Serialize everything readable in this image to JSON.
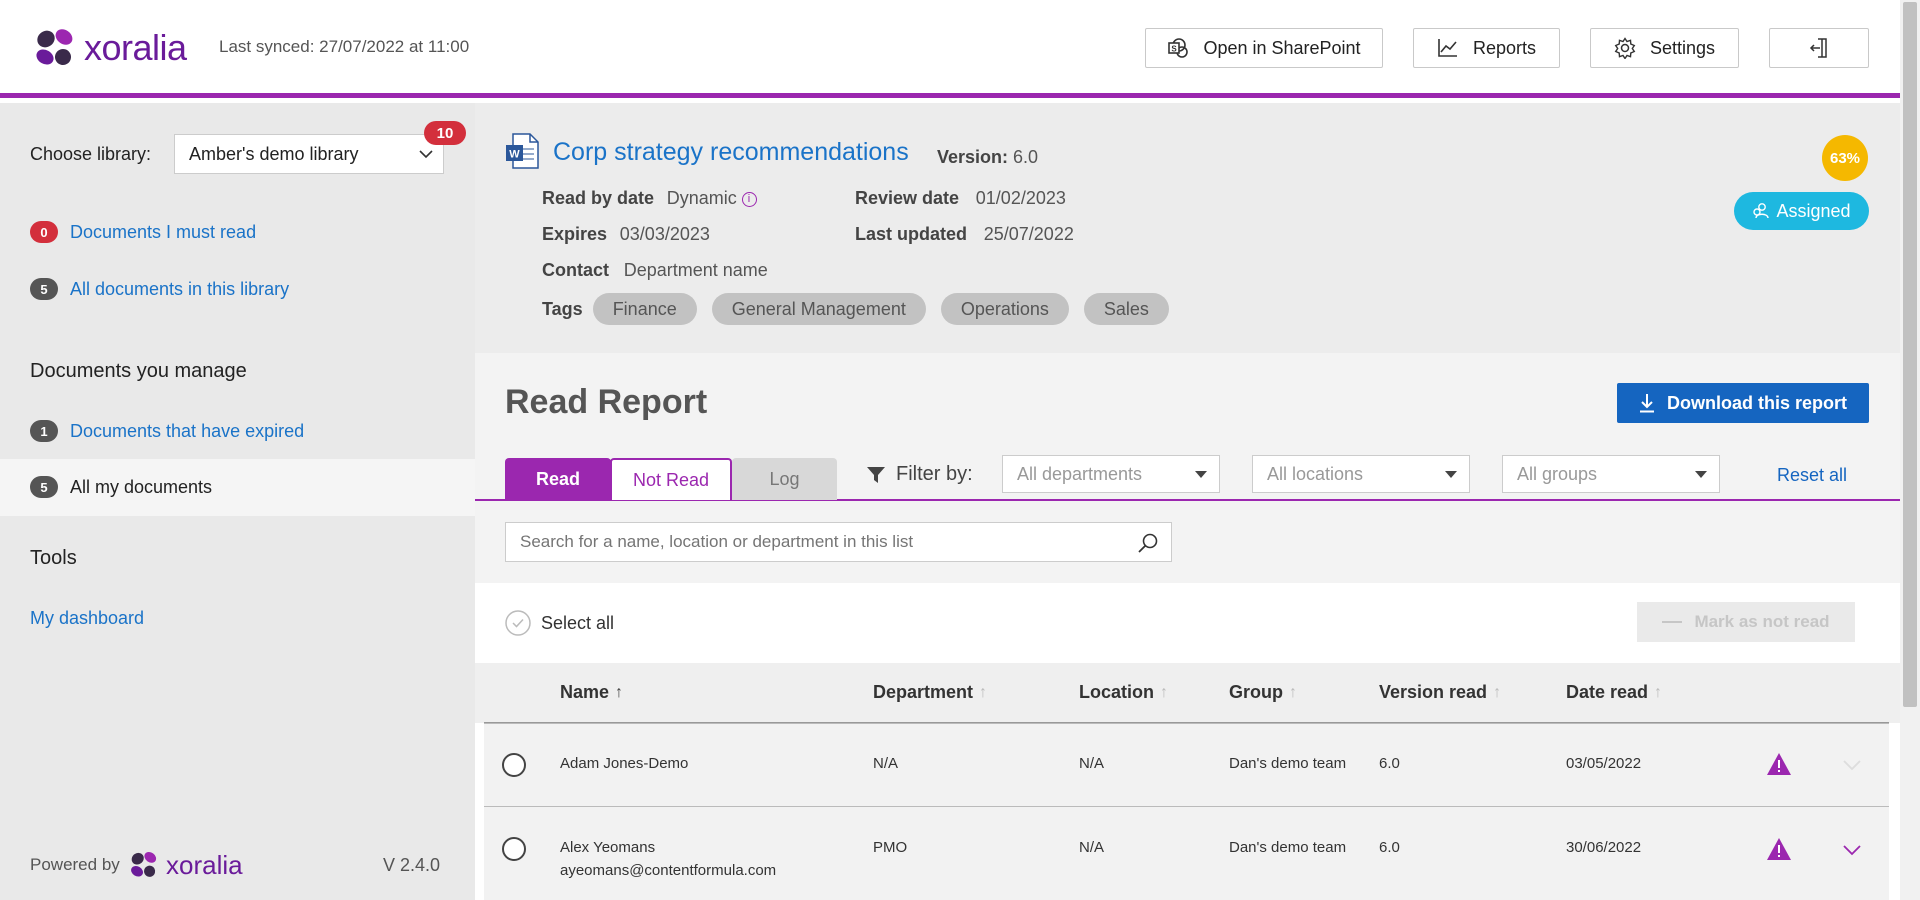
{
  "header": {
    "brand": "xoralia",
    "last_synced": "Last synced: 27/07/2022 at 11:00",
    "open_sharepoint": "Open in SharePoint",
    "reports": "Reports",
    "settings": "Settings"
  },
  "sidebar": {
    "choose_library_label": "Choose library:",
    "library_selected": "Amber's demo library",
    "library_badge": "10",
    "links": [
      {
        "count": "0",
        "label": "Documents I must read"
      },
      {
        "count": "5",
        "label": "All documents in this library"
      }
    ],
    "manage_heading": "Documents you manage",
    "manage_links": [
      {
        "count": "1",
        "label": "Documents that have expired"
      },
      {
        "count": "5",
        "label": "All my documents"
      }
    ],
    "tools_heading": "Tools",
    "dashboard": "My dashboard",
    "powered_by": "Powered by",
    "powered_brand": "xoralia",
    "version": "V 2.4.0"
  },
  "document": {
    "title": "Corp strategy recommendations",
    "version_label": "Version:",
    "version_value": "6.0",
    "read_by_label": "Read by date",
    "read_by_value": "Dynamic",
    "review_label": "Review date",
    "review_value": "01/02/2023",
    "expires_label": "Expires",
    "expires_value": "03/03/2023",
    "updated_label": "Last updated",
    "updated_value": "25/07/2022",
    "contact_label": "Contact",
    "contact_value": "Department name",
    "tags_label": "Tags",
    "tags": [
      "Finance",
      "General Management",
      "Operations",
      "Sales"
    ],
    "percent": "63%",
    "status": "Assigned"
  },
  "report": {
    "title": "Read Report",
    "download": "Download this report",
    "tabs": [
      "Read",
      "Not Read",
      "Log"
    ],
    "filter_label": "Filter by:",
    "filters": [
      "All departments",
      "All locations",
      "All groups"
    ],
    "reset": "Reset all",
    "search_placeholder": "Search for a name, location or department in this list",
    "select_all": "Select all",
    "mark_not_read": "Mark as not read"
  },
  "table": {
    "columns": [
      "Name",
      "Department",
      "Location",
      "Group",
      "Version read",
      "Date read"
    ],
    "rows": [
      {
        "name": "Adam Jones-Demo",
        "email": "",
        "department": "N/A",
        "location": "N/A",
        "group": "Dan's demo team",
        "version": "6.0",
        "date": "03/05/2022"
      },
      {
        "name": "Alex Yeomans",
        "email": "ayeomans@contentformula.com",
        "department": "PMO",
        "location": "N/A",
        "group": "Dan's demo team",
        "version": "6.0",
        "date": "30/06/2022"
      }
    ]
  },
  "colors": {
    "brand_purple": "#9b27af",
    "link_blue": "#1a73c8",
    "download_blue": "#1565c0",
    "badge_red": "#d32f3c",
    "percent_yellow": "#f5b800",
    "assigned_cyan": "#1eb8e0"
  }
}
